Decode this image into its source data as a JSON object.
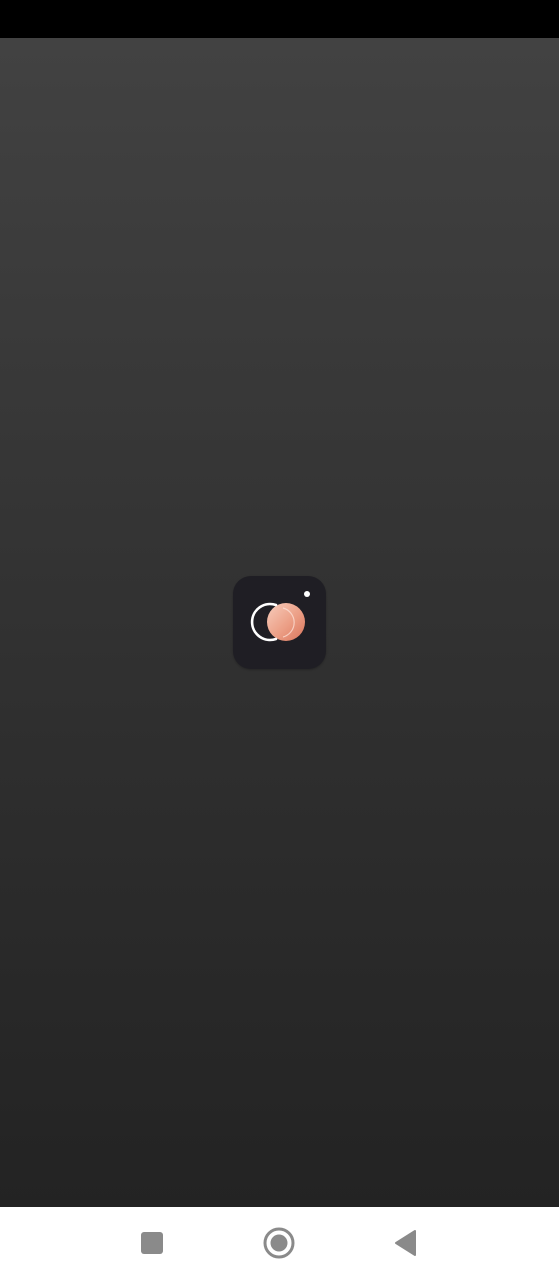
{
  "app": {
    "icon": "camera-filter-app-icon",
    "icon_background": "#1f1e24",
    "accent_gradient": [
      "#f6c7b8",
      "#e08a70"
    ]
  },
  "splash": {
    "background_top": "#424242",
    "background_bottom": "#232323"
  },
  "status_bar": {
    "background": "#000000"
  },
  "navigation": {
    "background": "#ffffff",
    "icon_color": "#8a8a8a",
    "buttons": [
      {
        "name": "recents",
        "icon": "square-icon"
      },
      {
        "name": "home",
        "icon": "circle-icon"
      },
      {
        "name": "back",
        "icon": "triangle-back-icon"
      }
    ]
  }
}
